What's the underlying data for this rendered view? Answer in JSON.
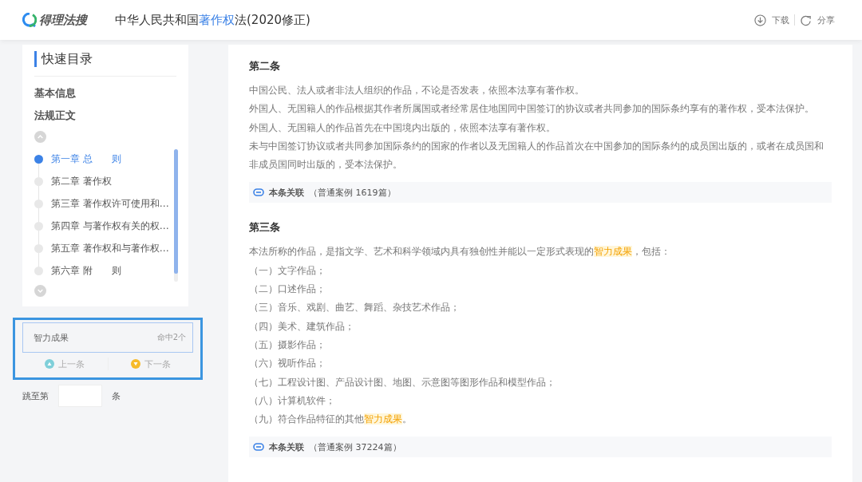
{
  "header": {
    "logo_text": "得理法搜",
    "title": [
      {
        "text": "中华人民共和国",
        "highlight": false
      },
      {
        "text": "著作权",
        "highlight": true
      },
      {
        "text": "法(2020修正)",
        "highlight": false
      }
    ],
    "actions": [
      {
        "kind": "download",
        "label": "下载"
      },
      {
        "kind": "share",
        "label": "分享"
      }
    ]
  },
  "sidebar": {
    "title": "快速目录",
    "sections": [
      "基本信息",
      "法规正文"
    ],
    "chapters": [
      {
        "label": "第一章 总　　则",
        "selected": true
      },
      {
        "label": "第二章 著作权",
        "selected": false
      },
      {
        "label": "第三章 著作权许可使用和…",
        "selected": false
      },
      {
        "label": "第四章 与著作权有关的权…",
        "selected": false
      },
      {
        "label": "第五章 著作权和与著作权…",
        "selected": false
      },
      {
        "label": "第六章 附　　则",
        "selected": false
      }
    ]
  },
  "search": {
    "value": "智力成果",
    "count": "命中2个",
    "prev": "上一条",
    "next": "下一条"
  },
  "jump": {
    "label": "跳至第",
    "suffix": "条"
  },
  "articles": [
    {
      "heading": "第二条",
      "lines": [
        [
          {
            "text": "中国公民、法人或者非法人组织的作品，不论是否发表，依照本法享有著作权。",
            "highlight": false
          }
        ],
        [
          {
            "text": "外国人、无国籍人的作品根据其作者所属国或者经常居住地国同中国签订的协议或者共同参加的国际条约享有的著作权，受本法保护。",
            "highlight": false
          }
        ],
        [
          {
            "text": "外国人、无国籍人的作品首先在中国境内出版的，依照本法享有著作权。",
            "highlight": false
          }
        ],
        [
          {
            "text": "未与中国签订协议或者共同参加国际条约的国家的作者以及无国籍人的作品首次在中国参加的国际条约的成员国出版的，或者在成员国和非成员国同时出版的，受本法保护。",
            "highlight": false
          }
        ]
      ],
      "related": {
        "label": "本条关联",
        "detail": "（普通案例 1619篇）"
      }
    },
    {
      "heading": "第三条",
      "lines": [
        [
          {
            "text": "本法所称的作品，是指文学、艺术和科学领域内具有独创性并能以一定形式表现的",
            "highlight": false
          },
          {
            "text": "智力成果",
            "highlight": true
          },
          {
            "text": "，包括：",
            "highlight": false
          }
        ],
        [
          {
            "text": "（一）文字作品；",
            "highlight": false
          }
        ],
        [
          {
            "text": "（二）口述作品；",
            "highlight": false
          }
        ],
        [
          {
            "text": "（三）音乐、戏剧、曲艺、舞蹈、杂技艺术作品；",
            "highlight": false
          }
        ],
        [
          {
            "text": "（四）美术、建筑作品；",
            "highlight": false
          }
        ],
        [
          {
            "text": "（五）摄影作品；",
            "highlight": false
          }
        ],
        [
          {
            "text": "（六）视听作品；",
            "highlight": false
          }
        ],
        [
          {
            "text": "（七）工程设计图、产品设计图、地图、示意图等图形作品和模型作品；",
            "highlight": false
          }
        ],
        [
          {
            "text": "（八）计算机软件；",
            "highlight": false
          }
        ],
        [
          {
            "text": "（九）符合作品特征的其他",
            "highlight": false
          },
          {
            "text": "智力成果",
            "highlight": true
          },
          {
            "text": "。",
            "highlight": false
          }
        ]
      ],
      "related": {
        "label": "本条关联",
        "detail": "（普通案例 37224篇）"
      }
    }
  ]
}
